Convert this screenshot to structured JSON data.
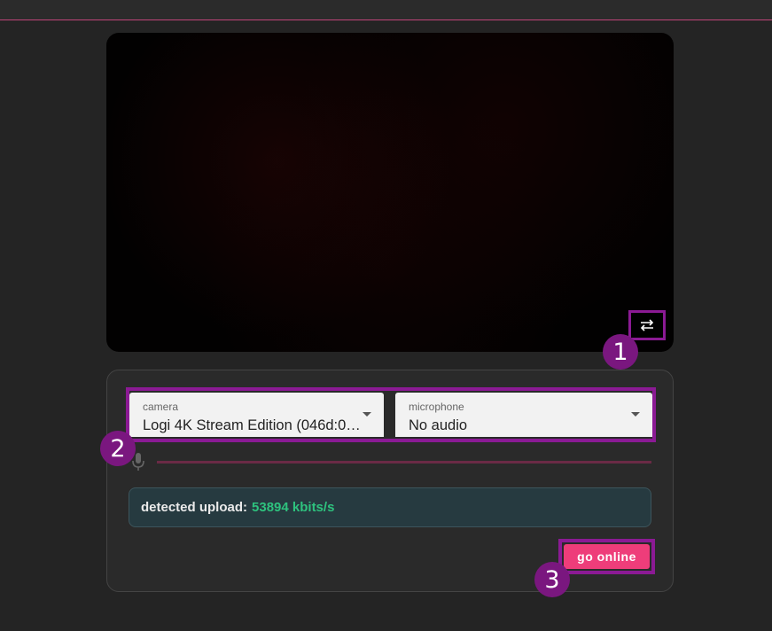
{
  "video": {
    "flip_icon": "swap-horizontal-icon"
  },
  "markers": [
    "1",
    "2",
    "3"
  ],
  "camera": {
    "label": "camera",
    "value": "Logi 4K Stream Edition (046d:0…"
  },
  "microphone": {
    "label": "microphone",
    "value": "No audio"
  },
  "mic_level": {
    "icon": "microphone-icon",
    "level": 0
  },
  "upload": {
    "label": "detected upload:",
    "value": "53894 kbits/s"
  },
  "actions": {
    "go_online": "go online"
  },
  "colors": {
    "accent": "#ee3d7a",
    "annotation": "#8b1a94",
    "upload_value": "#2ec27e"
  }
}
